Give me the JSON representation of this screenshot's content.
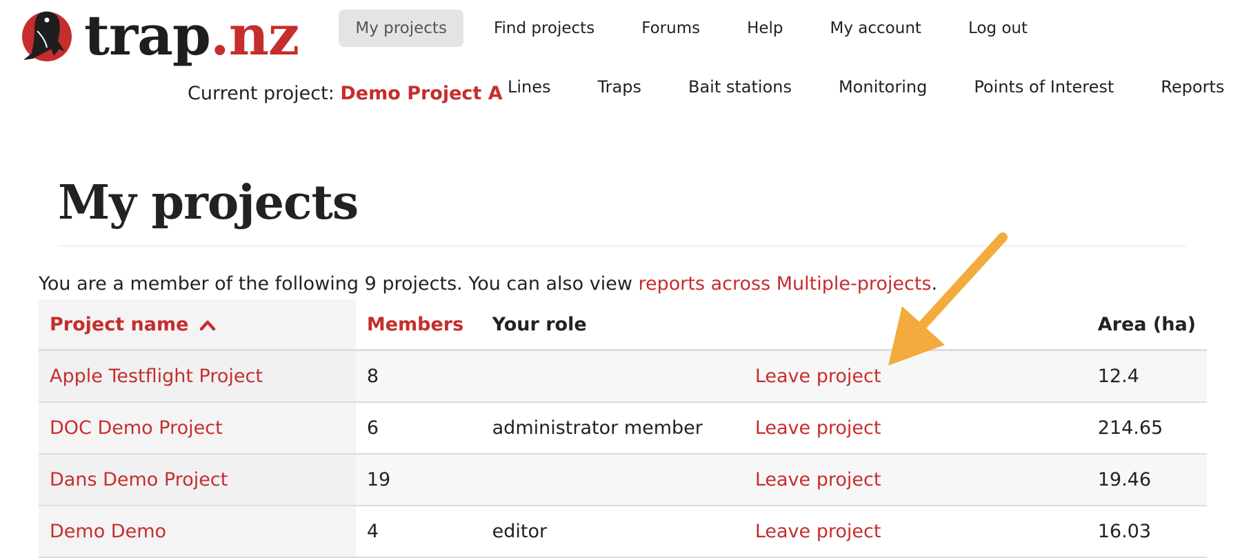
{
  "brand": {
    "name_main": "trap",
    "name_tld": ".nz",
    "logo_icon": "bird-logo-icon",
    "colors": {
      "accent": "#c62d2d",
      "dark": "#1e1e1e",
      "annotation": "#f2ab3c"
    }
  },
  "topnav": {
    "items": [
      {
        "label": "My projects",
        "active": true
      },
      {
        "label": "Find projects"
      },
      {
        "label": "Forums"
      },
      {
        "label": "Help"
      },
      {
        "label": "My account"
      },
      {
        "label": "Log out"
      }
    ]
  },
  "current_project": {
    "prefix": "Current project:",
    "name": "Demo Project A"
  },
  "subnav": {
    "items": [
      {
        "label": "Lines"
      },
      {
        "label": "Traps"
      },
      {
        "label": "Bait stations"
      },
      {
        "label": "Monitoring"
      },
      {
        "label": "Points of Interest"
      },
      {
        "label": "Reports"
      }
    ]
  },
  "page": {
    "title": "My projects",
    "intro_text": "You are a member of the following 9 projects. You can also view ",
    "intro_link": "reports across Multiple-projects",
    "intro_end": "."
  },
  "table": {
    "headers": {
      "name": "Project name",
      "members": "Members",
      "role": "Your role",
      "action": "",
      "area": "Area (ha)"
    },
    "sort_icon": "chevron-up-icon",
    "rows": [
      {
        "name": "Apple Testflight Project",
        "members": "8",
        "role": "",
        "action": "Leave project",
        "area": "12.4"
      },
      {
        "name": "DOC Demo Project",
        "members": "6",
        "role": "administrator member",
        "action": "Leave project",
        "area": "214.65"
      },
      {
        "name": "Dans Demo Project",
        "members": "19",
        "role": "",
        "action": "Leave project",
        "area": "19.46"
      },
      {
        "name": "Demo Demo",
        "members": "4",
        "role": "editor",
        "action": "Leave project",
        "area": "16.03"
      }
    ]
  },
  "annotation": {
    "icon": "pointer-arrow-icon"
  }
}
